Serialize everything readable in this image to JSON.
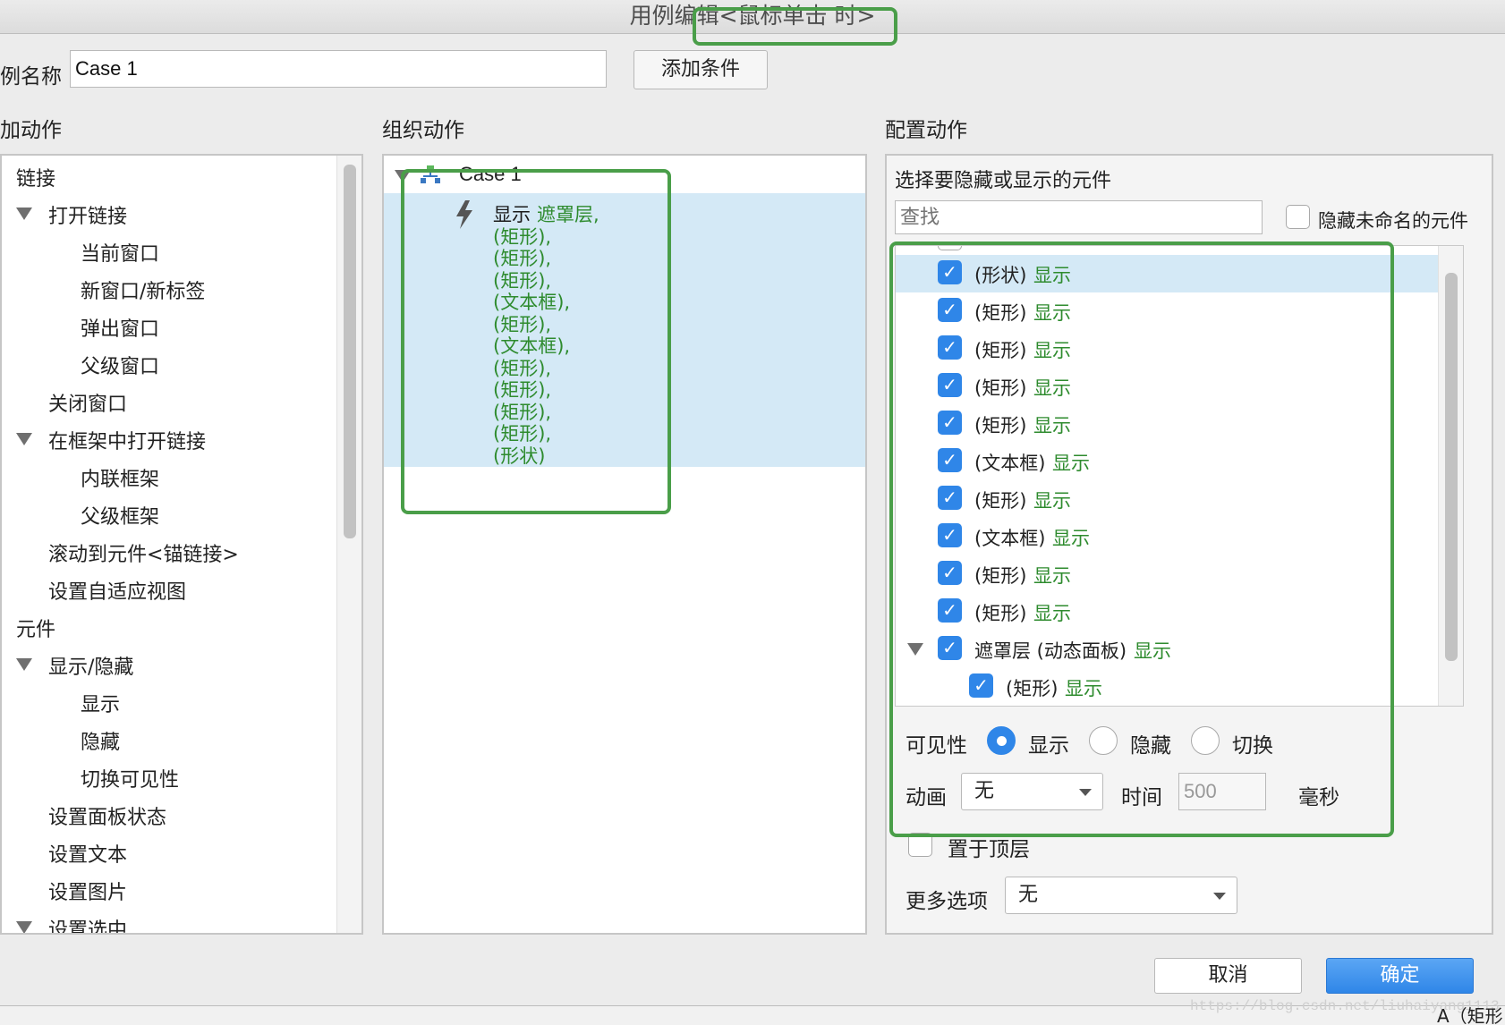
{
  "window": {
    "title": "用例编辑<鼠标单击 时>"
  },
  "case": {
    "name_label": "例名称",
    "name_value": "Case 1",
    "add_condition": "添加条件"
  },
  "columns": {
    "add_action": "加动作",
    "organize_action": "组织动作",
    "configure_action": "配置动作"
  },
  "actions_tree": [
    {
      "label": "链接",
      "level": 0,
      "expanded": null
    },
    {
      "label": "打开链接",
      "level": 1,
      "expanded": true
    },
    {
      "label": "当前窗口",
      "level": 2,
      "expanded": null
    },
    {
      "label": "新窗口/新标签",
      "level": 2,
      "expanded": null
    },
    {
      "label": "弹出窗口",
      "level": 2,
      "expanded": null
    },
    {
      "label": "父级窗口",
      "level": 2,
      "expanded": null
    },
    {
      "label": "关闭窗口",
      "level": 1,
      "expanded": null
    },
    {
      "label": "在框架中打开链接",
      "level": 1,
      "expanded": true
    },
    {
      "label": "内联框架",
      "level": 2,
      "expanded": null
    },
    {
      "label": "父级框架",
      "level": 2,
      "expanded": null
    },
    {
      "label": "滚动到元件<锚链接>",
      "level": 1,
      "expanded": null
    },
    {
      "label": "设置自适应视图",
      "level": 1,
      "expanded": null
    },
    {
      "label": "元件",
      "level": 0,
      "expanded": null
    },
    {
      "label": "显示/隐藏",
      "level": 1,
      "expanded": true
    },
    {
      "label": "显示",
      "level": 2,
      "expanded": null
    },
    {
      "label": "隐藏",
      "level": 2,
      "expanded": null
    },
    {
      "label": "切换可见性",
      "level": 2,
      "expanded": null
    },
    {
      "label": "设置面板状态",
      "level": 1,
      "expanded": null
    },
    {
      "label": "设置文本",
      "level": 1,
      "expanded": null
    },
    {
      "label": "设置图片",
      "level": 1,
      "expanded": null
    },
    {
      "label": "设置选中",
      "level": 1,
      "expanded": true
    }
  ],
  "organize": {
    "case_label": "Case 1",
    "action_verb": "显示",
    "action_targets": [
      "遮罩层,",
      "(矩形),",
      "(矩形),",
      "(矩形),",
      "(文本框),",
      "(矩形),",
      "(文本框),",
      "(矩形),",
      "(矩形),",
      "(矩形),",
      "(矩形),",
      "(形状)"
    ]
  },
  "configure": {
    "select_label": "选择要隐藏或显示的元件",
    "search_placeholder": "查找",
    "hide_unnamed_label": "隐藏未命名的元件",
    "widgets": [
      {
        "name": "(形状)",
        "state": "显示",
        "indent": 0,
        "checked": true,
        "selected": true
      },
      {
        "name": "(矩形)",
        "state": "显示",
        "indent": 0,
        "checked": true,
        "selected": false
      },
      {
        "name": "(矩形)",
        "state": "显示",
        "indent": 0,
        "checked": true,
        "selected": false
      },
      {
        "name": "(矩形)",
        "state": "显示",
        "indent": 0,
        "checked": true,
        "selected": false
      },
      {
        "name": "(矩形)",
        "state": "显示",
        "indent": 0,
        "checked": true,
        "selected": false
      },
      {
        "name": "(文本框)",
        "state": "显示",
        "indent": 0,
        "checked": true,
        "selected": false
      },
      {
        "name": "(矩形)",
        "state": "显示",
        "indent": 0,
        "checked": true,
        "selected": false
      },
      {
        "name": "(文本框)",
        "state": "显示",
        "indent": 0,
        "checked": true,
        "selected": false
      },
      {
        "name": "(矩形)",
        "state": "显示",
        "indent": 0,
        "checked": true,
        "selected": false
      },
      {
        "name": "(矩形)",
        "state": "显示",
        "indent": 0,
        "checked": true,
        "selected": false
      },
      {
        "name": "遮罩层 (动态面板)",
        "state": "显示",
        "indent": 0,
        "checked": true,
        "selected": false,
        "expanded": true
      },
      {
        "name": "(矩形)",
        "state": "显示",
        "indent": 1,
        "checked": true,
        "selected": false
      }
    ],
    "visibility_label": "可见性",
    "visibility_options": [
      "显示",
      "隐藏",
      "切换"
    ],
    "visibility_selected": "显示",
    "animation_label": "动画",
    "animation_value": "无",
    "time_label": "时间",
    "time_value": "500",
    "time_unit": "毫秒",
    "bring_to_front": "置于顶层",
    "more_options_label": "更多选项",
    "more_options_value": "无"
  },
  "footer": {
    "cancel": "取消",
    "ok": "确定",
    "watermark": "https://blog.csdn.net/liuhaiyang1113",
    "behind_text": "A（矩形"
  },
  "colors": {
    "accent": "#2f86e8",
    "highlight_green": "#4a9e49",
    "action_green": "#2e8b2e",
    "selection_blue": "#d4e9f6"
  }
}
